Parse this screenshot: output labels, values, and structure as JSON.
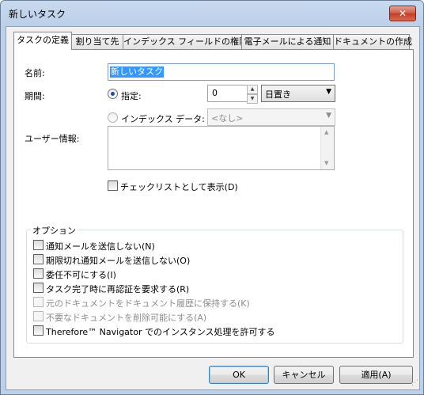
{
  "window": {
    "title": "新しいタスク",
    "close_label": "✕"
  },
  "tabs": [
    {
      "label": "タスクの定義"
    },
    {
      "label": "割り当て先"
    },
    {
      "label": "インデックス フィールドの権限"
    },
    {
      "label": "電子メールによる通知"
    },
    {
      "label": "ドキュメントの作成"
    }
  ],
  "form": {
    "name_label": "名前:",
    "name_value": "新しいタスク",
    "period_label": "期間:",
    "specified_label": "指定:",
    "spin_value": "0",
    "unit_value": "日置き",
    "index_data_label": "インデックス データ:",
    "index_data_value": "<なし>",
    "user_info_label": "ユーザー情報:",
    "checklist_label": "チェックリストとして表示(D)"
  },
  "options": {
    "legend": "オプション",
    "items": [
      {
        "label": "通知メールを送信しない(N)",
        "enabled": true
      },
      {
        "label": "期限切れ通知メールを送信しない(O)",
        "enabled": true
      },
      {
        "label": "委任不可にする(I)",
        "enabled": true
      },
      {
        "label": "タスク完了時に再認証を要求する(R)",
        "enabled": true
      },
      {
        "label": "元のドキュメントをドキュメント履歴に保持する(K)",
        "enabled": false
      },
      {
        "label": "不要なドキュメントを削除可能にする(A)",
        "enabled": false
      },
      {
        "label": "Therefore™ Navigator でのインスタンス処理を許可する",
        "enabled": true
      }
    ]
  },
  "buttons": {
    "ok": "OK",
    "cancel": "キャンセル",
    "apply": "適用(A)"
  },
  "colors": {
    "selection": "#3399ff",
    "window_frame": "#bcd0ea",
    "close_button": "#c33b25"
  },
  "icons": {
    "close": "close-icon",
    "spin_up": "caret-up-icon",
    "spin_down": "caret-down-icon",
    "dropdown": "caret-down-icon"
  }
}
